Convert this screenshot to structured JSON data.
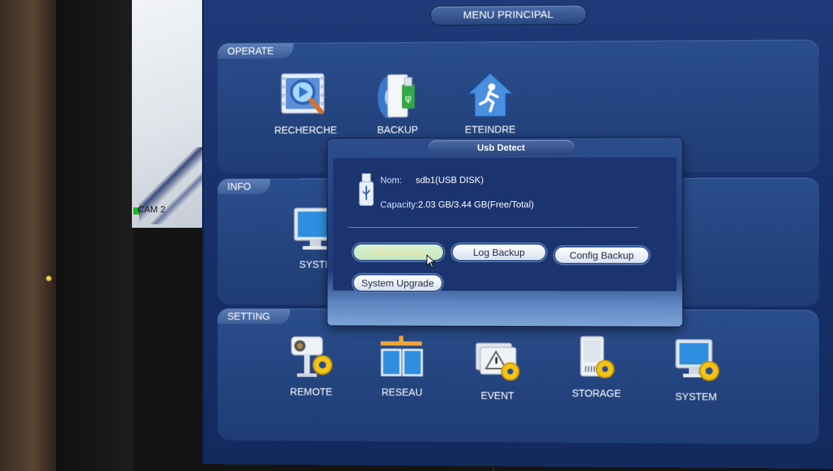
{
  "camera": {
    "label": "CAM 2"
  },
  "main_menu": {
    "title": "MENU PRINCIPAL",
    "sections": {
      "operate": {
        "title": "OPERATE",
        "items": [
          {
            "label": "RECHERCHE",
            "icon": "search-video-icon"
          },
          {
            "label": "BACKUP",
            "icon": "usb-backup-icon"
          },
          {
            "label": "ETEINDRE",
            "icon": "house-exit-icon"
          }
        ]
      },
      "info": {
        "title": "INFO",
        "items": [
          {
            "label": "SYSTEI",
            "icon": "monitor-icon"
          }
        ]
      },
      "setting": {
        "title": "SETTING",
        "items": [
          {
            "label": "REMOTE",
            "icon": "camera-gear-icon"
          },
          {
            "label": "RESEAU",
            "icon": "network-gear-icon"
          },
          {
            "label": "EVENT",
            "icon": "alert-gear-icon"
          },
          {
            "label": "STORAGE",
            "icon": "hdd-gear-icon"
          },
          {
            "label": "SYSTEM",
            "icon": "monitor-gear-icon"
          }
        ]
      }
    }
  },
  "usb_dialog": {
    "title": "Usb Detect",
    "name_label": "Nom:",
    "name_value": "sdb1(USB DISK)",
    "capacity_label": "Capacity:",
    "capacity_value": "2.03 GB/3.44 GB(Free/Total)",
    "buttons": {
      "file_backup": "File Backup",
      "log_backup": "Log Backup",
      "config_backup": "Config Backup",
      "system_upgrade": "System Upgrade"
    }
  },
  "colors": {
    "panel_blue": "#24447f",
    "screen_blue": "#17316b",
    "gear_yellow": "#f4c417",
    "button_white": "#ffffff"
  }
}
